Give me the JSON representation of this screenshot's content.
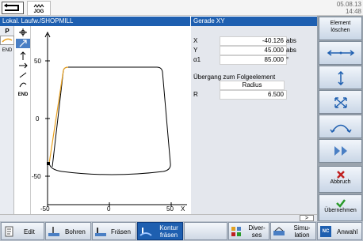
{
  "topbar": {
    "mode_label": "JOG",
    "date_line1": "05.08.13",
    "date_line2": "14:48"
  },
  "titles": {
    "left": "Lokal. Laufw./SHOPMILL",
    "right": "Gerade XY"
  },
  "palette": {
    "plane_label": "P",
    "end_label": "END",
    "end_label_tools": "END"
  },
  "graphic": {
    "y_ticks": [
      "50",
      "0",
      "-50"
    ],
    "x_ticks": [
      "-50",
      "0",
      "50"
    ],
    "y_axis_label": "Y",
    "x_axis_label": "X",
    "contour_color": "#000000",
    "highlight_color": "#e8a020"
  },
  "params": {
    "rows": [
      {
        "label": "X",
        "value": "-40.126",
        "unit": "abs"
      },
      {
        "label": "Y",
        "value": "45.000",
        "unit": "abs"
      },
      {
        "label": "α1",
        "value": "85.000",
        "unit": "°"
      }
    ],
    "transition_heading": "Übergang zum Folgeelement",
    "transition_type": "Radius",
    "radius_label": "R",
    "radius_value": "6.500"
  },
  "softkeys": {
    "element_delete": "Element\nlöschen",
    "cancel": "Abbruch",
    "accept": "Übernehmen"
  },
  "bottombar": {
    "edit": "Edit",
    "drill": "Bohren",
    "mill": "Fräsen",
    "contour_mill_1": "Kontur",
    "contour_mill_2": "fräsen",
    "misc_1": "Diver-",
    "misc_2": "ses",
    "sim_1": "Simu-",
    "sim_2": "lation",
    "nc": "NC",
    "execute": "Anwahl",
    "scroll_arrow": ">"
  },
  "colors": {
    "title_blue": "#1e5fb0",
    "active_softkey": "#1e5fb0",
    "accept_green": "#2a9a2a",
    "cancel_red": "#c02020"
  }
}
